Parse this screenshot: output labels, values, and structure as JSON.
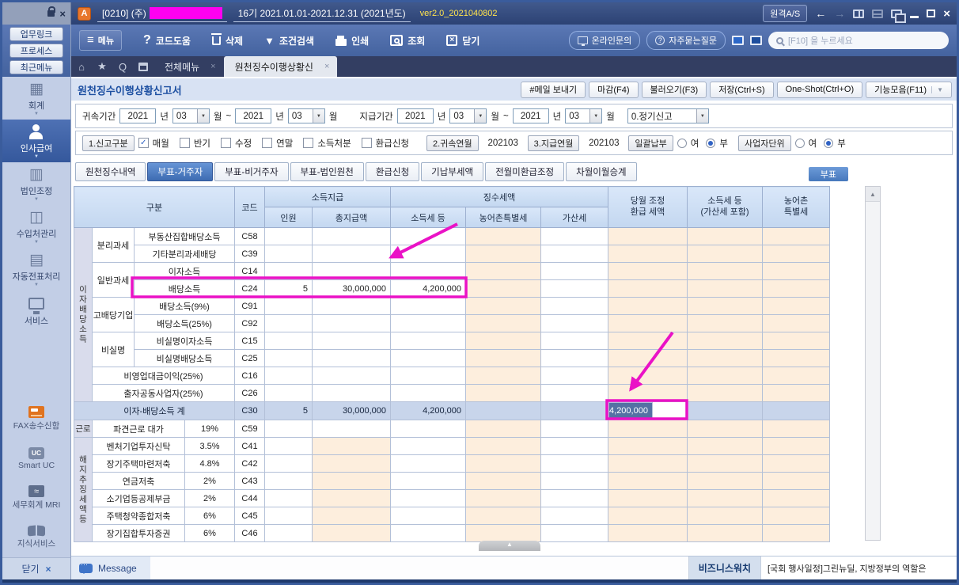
{
  "colors": {
    "annotation_magenta": "#ea12c6",
    "active_tab_blue": "#3e6cb2",
    "disabled_cell_peach": "#fdeedd",
    "selected_cell_blue": "#5471a4",
    "toolbar_blue": "#44639f"
  },
  "icons": {
    "logo": "A",
    "close_x": "×",
    "menu_lines": "≡",
    "help": "?",
    "filter_caret": "▼",
    "caret_down": "▼",
    "home": "⌂",
    "star": "★",
    "quick_q": "Q",
    "collapse_up": "▲",
    "scroll_up": "▲",
    "uc": "UC",
    "mri_wave": "≈",
    "check": "✓",
    "back_arrow": "←",
    "fwd_arrow": "→",
    "min": "─",
    "side_caret": "▼"
  },
  "titlebar": {
    "company_code": "[0210]  (주)",
    "fiscal_period": "16기  2021.01.01-2021.12.31  (2021년도)",
    "version": "ver2.0_2021040802",
    "remote_btn": "원격A/S"
  },
  "toolbar": {
    "menu": "메뉴",
    "code_help": "코드도움",
    "delete": "삭제",
    "cond_search": "조건검색",
    "print": "인쇄",
    "inquiry": "조회",
    "close": "닫기",
    "online_inquiry": "온라인문의",
    "faq": "자주묻는질문",
    "quick_search_placeholder": "[F10]  을  누르세요"
  },
  "tabbar": {
    "tab_all_menu": "전체메뉴",
    "tab_current": "원천징수이행상황신"
  },
  "sidebar": {
    "top_buttons": [
      {
        "label": "업무링크"
      },
      {
        "label": "프로세스"
      },
      {
        "label": "최근메뉴"
      }
    ],
    "menu": [
      {
        "label": "회계"
      },
      {
        "label": "인사급여",
        "active": true
      },
      {
        "label": "법인조정"
      },
      {
        "label": "수입처관리"
      },
      {
        "label": "자동전표처리"
      },
      {
        "label": "서비스"
      }
    ],
    "tools": [
      {
        "label": "FAX송수신함"
      },
      {
        "label": "Smart UC"
      },
      {
        "label": "세무회계 MRI"
      },
      {
        "label": "지식서비스"
      }
    ],
    "close": "닫기"
  },
  "page": {
    "title": "원천징수이행상황신고서",
    "actions": [
      {
        "label": "#메일 보내기"
      },
      {
        "label": "마감(F4)"
      },
      {
        "label": "불러오기(F3)"
      },
      {
        "label": "저장(Ctrl+S)"
      },
      {
        "label": "One-Shot(Ctrl+O)"
      },
      {
        "label": "기능모음(F11)",
        "dropdown": true
      }
    ]
  },
  "filters": {
    "attr_label": "귀속기간",
    "pay_label": "지급기간",
    "year_suffix": "년",
    "month_suffix": "월",
    "tilde": "~",
    "attr_from_y": "2021",
    "attr_from_m": "03",
    "attr_to_y": "2021",
    "attr_to_m": "03",
    "pay_from_y": "2021",
    "pay_from_m": "03",
    "pay_to_y": "2021",
    "pay_to_m": "03",
    "report_kind": "0.정기신고"
  },
  "declare": {
    "report_div_label": "1.신고구분",
    "checks": [
      {
        "label": "매월",
        "checked": true
      },
      {
        "label": "반기",
        "checked": false
      },
      {
        "label": "수정",
        "checked": false
      },
      {
        "label": "연말",
        "checked": false
      },
      {
        "label": "소득처분",
        "checked": false
      },
      {
        "label": "환급신청",
        "checked": false
      }
    ],
    "attr_ym_label": "2.귀속연월",
    "attr_ym": "202103",
    "pay_ym_label": "3.지급연월",
    "pay_ym": "202103",
    "lump_label": "일괄납부",
    "yes": "여",
    "no": "부",
    "lump_value": "부",
    "biz_label": "사업자단위",
    "biz_value": "부"
  },
  "sheettabs": {
    "items": [
      {
        "label": "원천징수내역"
      },
      {
        "label": "부표-거주자",
        "active": true
      },
      {
        "label": "부표-비거주자"
      },
      {
        "label": "부표-법인원천"
      },
      {
        "label": "환급신청"
      },
      {
        "label": "기납부세액"
      },
      {
        "label": "전월미환급조정"
      },
      {
        "label": "차월이월승계"
      }
    ],
    "subtable_btn": "부표"
  },
  "table": {
    "h": {
      "gubun": "구분",
      "code": "코드",
      "sodeuk_jigeup": "소득지급",
      "jingsu": "징수세액",
      "inwon": "인원",
      "chong": "총지급액",
      "sodeukse": "소득세 등",
      "nongteuk": "농어촌특별세",
      "gasan": "가산세",
      "dangwol": "당월 조정\n환급 세액",
      "sodeukpo": "소득세 등\n(가산세 포함)",
      "nong2": "농어촌\n특별세"
    },
    "rows": [
      {
        "code": "C58",
        "g1": {
          "t": "이자배당소득",
          "s": 10,
          "v": true
        },
        "g2": {
          "t": "분리과세",
          "s": 2
        },
        "item": "부동산집합배당소득"
      },
      {
        "code": "C39",
        "item": "기타분리과세배당"
      },
      {
        "code": "C14",
        "g2": {
          "t": "일반과세",
          "s": 2
        },
        "item": "이자소득"
      },
      {
        "code": "C24",
        "item": "배당소득",
        "cells": {
          "inwon": "5",
          "chong": "30,000,000",
          "sodeukse": "4,200,000"
        }
      },
      {
        "code": "C91",
        "g2": {
          "t": "고배당기업",
          "s": 2
        },
        "item": "배당소득(9%)"
      },
      {
        "code": "C92",
        "item": "배당소득(25%)"
      },
      {
        "code": "C15",
        "g2": {
          "t": "비실명",
          "s": 2
        },
        "item": "비실명이자소득"
      },
      {
        "code": "C25",
        "item": "비실명배당소득"
      },
      {
        "code": "C16",
        "item": "비영업대금이익(25%)",
        "wide": true
      },
      {
        "code": "C26",
        "item": "출자공동사업자(25%)",
        "wide": true
      },
      {
        "code": "C30",
        "item": "이자-배당소득 계",
        "total": true,
        "cells": {
          "inwon": "5",
          "chong": "30,000,000",
          "sodeukse": "4,200,000",
          "dangwol": "4,200,000"
        },
        "selected": "dangwol"
      },
      {
        "code": "C59",
        "g1": {
          "t": "근로",
          "s": 1
        },
        "item": "파견근로 대가",
        "rate": "19%"
      },
      {
        "code": "C41",
        "g1": {
          "t": "해지추징세액등",
          "s": 6,
          "v": true
        },
        "item": "벤처기업투자신탁",
        "rate": "3.5%",
        "peach_chong": true
      },
      {
        "code": "C42",
        "item": "장기주택마련저축",
        "rate": "4.8%",
        "peach_chong": true
      },
      {
        "code": "C43",
        "item": "연금저축",
        "rate": "2%",
        "peach_chong": true
      },
      {
        "code": "C44",
        "item": "소기업등공제부금",
        "rate": "2%",
        "peach_chong": true
      },
      {
        "code": "C45",
        "item": "주택청약종합저축",
        "rate": "6%",
        "peach_chong": true
      },
      {
        "code": "C46",
        "item": "장기집합투자증권",
        "rate": "6%",
        "peach_chong": true
      }
    ]
  },
  "statusbar": {
    "message": "Message",
    "news_source": "비즈니스워치",
    "news": "[국회 행사일정]그린뉴딜, 지방정부의 역할은"
  }
}
